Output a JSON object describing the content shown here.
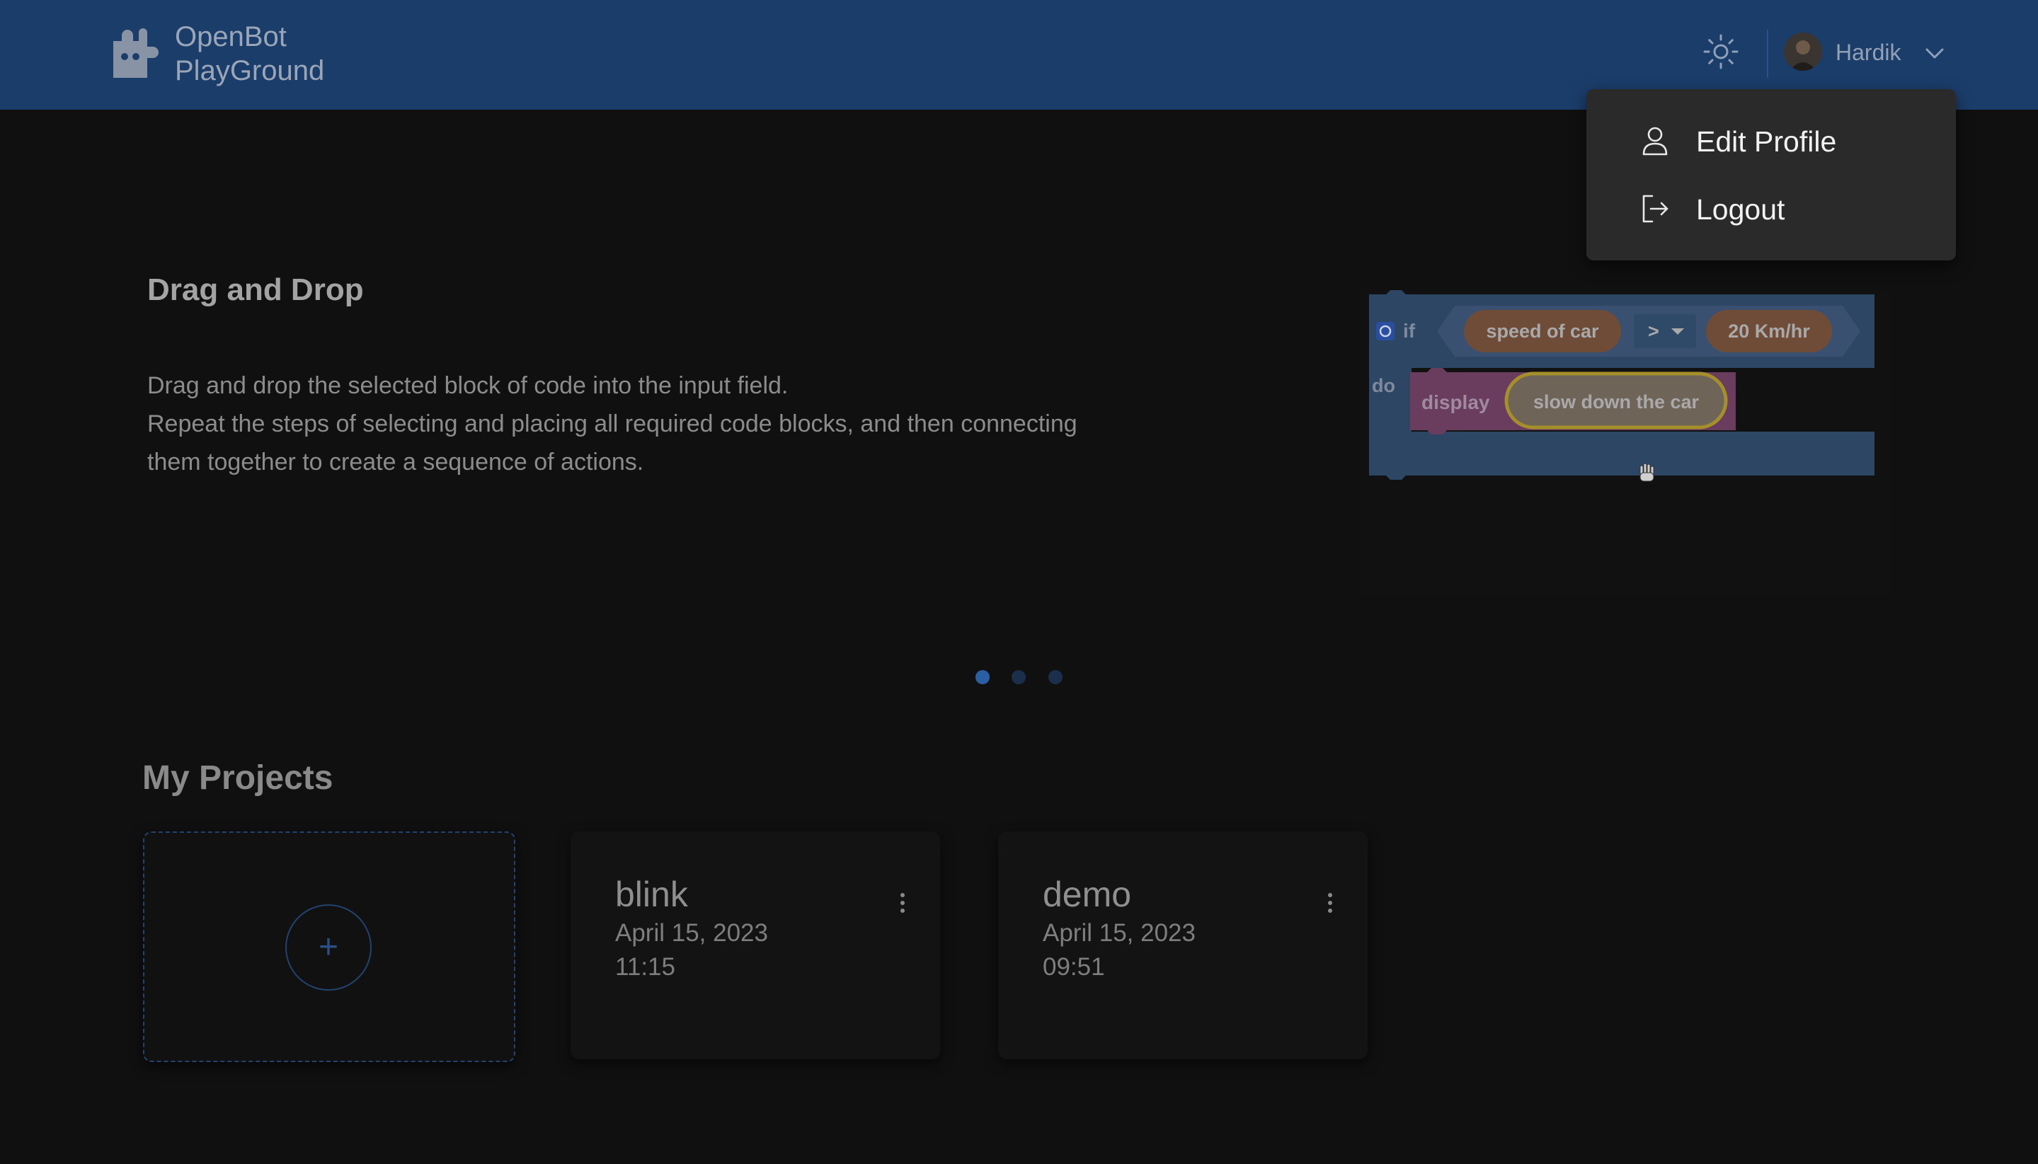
{
  "header": {
    "brand_line1": "OpenBot",
    "brand_line2": "PlayGround",
    "username": "Hardik",
    "icons": {
      "logo": "robot-puzzle-logo",
      "theme": "sun-icon",
      "dropdown": "chevron-down-icon"
    }
  },
  "user_menu": {
    "items": [
      {
        "label": "Edit Profile",
        "icon": "person-icon"
      },
      {
        "label": "Logout",
        "icon": "logout-icon"
      }
    ]
  },
  "carousel": {
    "title": "Drag and Drop",
    "lines": [
      "Drag and drop the selected block of code into the input field.",
      "Repeat the steps of selecting and placing all required code blocks, and then connecting",
      "them together to create a sequence of actions."
    ],
    "image": {
      "if_label": "if",
      "condition_left": "speed of car",
      "operator": ">",
      "condition_right": "20 Km/hr",
      "do_label": "do",
      "action": "display",
      "message": "slow down the car"
    },
    "slides_total": 3,
    "active_slide": 1
  },
  "projects": {
    "title": "My Projects",
    "new_icon": "+",
    "items": [
      {
        "name": "blink",
        "date": "April 15, 2023",
        "time": "11:15"
      },
      {
        "name": "demo",
        "date": "April 15, 2023",
        "time": "09:51"
      }
    ]
  },
  "colors": {
    "header_bg": "#1b3d6a",
    "page_bg": "#101010",
    "menu_bg": "#2a2a2a",
    "accent": "#22436f"
  }
}
